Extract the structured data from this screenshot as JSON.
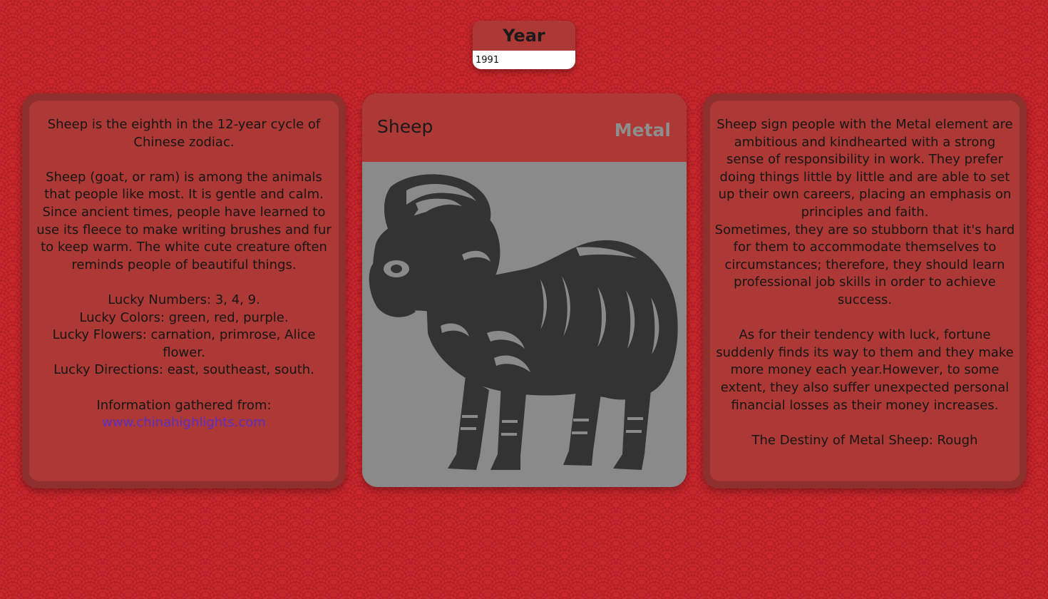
{
  "year_selector": {
    "label": "Year",
    "value": "1991"
  },
  "left_card": {
    "intro": "Sheep is the eighth in the 12-year cycle of Chinese zodiac.",
    "description": "Sheep (goat, or ram) is among the animals that people like most. It is gentle and calm. Since ancient times, people have learned to use its fleece to make writing brushes and fur to keep warm. The white cute creature often reminds people of beautiful things.",
    "lucky_numbers": "Lucky Numbers: 3, 4, 9.",
    "lucky_colors": "Lucky Colors: green, red, purple.",
    "lucky_flowers": "Lucky Flowers: carnation, primrose, Alice flower.",
    "lucky_directions": "Lucky Directions: east, southeast, south.",
    "source_label": "Information gathered from:",
    "source_link": "www.chinahighlights.com"
  },
  "center_card": {
    "animal": "Sheep",
    "element": "Metal",
    "image_icon": "sheep-papercut-icon"
  },
  "right_card": {
    "personality": "Sheep sign people with the Metal element are ambitious and kindhearted with a strong sense of responsibility in work. They prefer doing things little by little and are able to set up their own careers, placing an emphasis on principles and faith.",
    "weakness": "Sometimes, they are so stubborn that it's hard for them to accommodate themselves to circumstances; therefore, they should learn professional job skills in order to achieve success.",
    "luck": "As for their tendency with luck, fortune suddenly finds its way to them and they make more money each year.However, to some extent, they also suffer unexpected personal financial losses as their money increases.",
    "destiny": "The Destiny of Metal Sheep: Rough"
  },
  "colors": {
    "background": "#c8272c",
    "card": "#ad3936",
    "card_border": "#8f302e",
    "image_bg": "#8a8a8a",
    "link": "#5b2fc4"
  }
}
